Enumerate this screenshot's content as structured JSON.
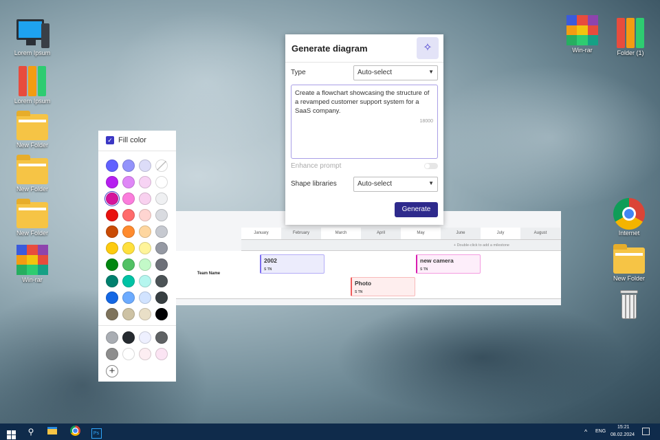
{
  "desktop": {
    "left": [
      {
        "label": "Lorem Ipsum",
        "icon": "computer-icon"
      },
      {
        "label": "Lorem Ipsum",
        "icon": "binders-icon"
      },
      {
        "label": "New Folder",
        "icon": "folder-icon"
      },
      {
        "label": "New Folder",
        "icon": "folder-icon"
      },
      {
        "label": "New Folder",
        "icon": "folder-icon"
      },
      {
        "label": "Win-rar",
        "icon": "winrar-icon"
      }
    ],
    "right": [
      {
        "label": "Win-rar",
        "icon": "winrar-icon"
      },
      {
        "label": "Folder (1)",
        "icon": "binders-icon"
      },
      {
        "label": "Internet",
        "icon": "chrome-icon"
      },
      {
        "label": "New Folder",
        "icon": "folder-icon"
      },
      {
        "label": "",
        "icon": "recycle-bin-icon"
      }
    ]
  },
  "dialog": {
    "title": "Generate diagram",
    "type_label": "Type",
    "type_value": "Auto-select",
    "prompt": "Create a flowchart showcasing the structure of a revamped customer support system for a SaaS company.",
    "char_count": "18000",
    "enhance_label": "Enhance prompt",
    "enhance_on": false,
    "shape_label": "Shape libraries",
    "shape_value": "Auto-select",
    "generate_label": "Generate"
  },
  "timeline": {
    "months": [
      "January",
      "February",
      "March",
      "April",
      "May",
      "June",
      "July",
      "August"
    ],
    "milestone_hint": "+ Double-click to add a milestone",
    "team": "Team Name",
    "tasks": [
      {
        "title": "2002",
        "tags": "S  TN",
        "color": "#7b6cf0"
      },
      {
        "title": "new camera",
        "tags": "S  TN",
        "color": "#d81bb0"
      },
      {
        "title": "Photo",
        "tags": "S  TN",
        "color": "#f05a5a"
      }
    ]
  },
  "palette": {
    "label": "Fill color",
    "checked": true,
    "colors": [
      "#6161ff",
      "#9393fb",
      "#dcdcf8",
      "none",
      "#b61ef0",
      "#df87f7",
      "#f7d3f4",
      "#ffffff",
      "#d5139c",
      "#fb7ddc",
      "#f8d1ef",
      "#eff0f2",
      "#e8120f",
      "#ff6b6b",
      "#ffd5d1",
      "#d9dbe0",
      "#c94b05",
      "#ff8b2e",
      "#fed69f",
      "#c6c9d0",
      "#fdcb0e",
      "#ffe03d",
      "#fff49a",
      "#9599a3",
      "#018610",
      "#52c164",
      "#c3f9c8",
      "#6d7078",
      "#00806e",
      "#00c3a5",
      "#b5f6ef",
      "#4c5356",
      "#1467e4",
      "#6cabff",
      "#d1e3ff",
      "#383f42",
      "#7e735c",
      "#cdc2a4",
      "#e9dfc7",
      "#010103"
    ],
    "extra": [
      "#a9adb3",
      "#262b30",
      "#eef0ff",
      "#5f6264",
      "#8d8d8d",
      "#ffffff",
      "#fdeef2",
      "#fbe4f3"
    ],
    "selected": "#d5139c"
  },
  "taskbar": {
    "lang": "ENG",
    "time": "15:21",
    "date": "08.02.2024"
  }
}
